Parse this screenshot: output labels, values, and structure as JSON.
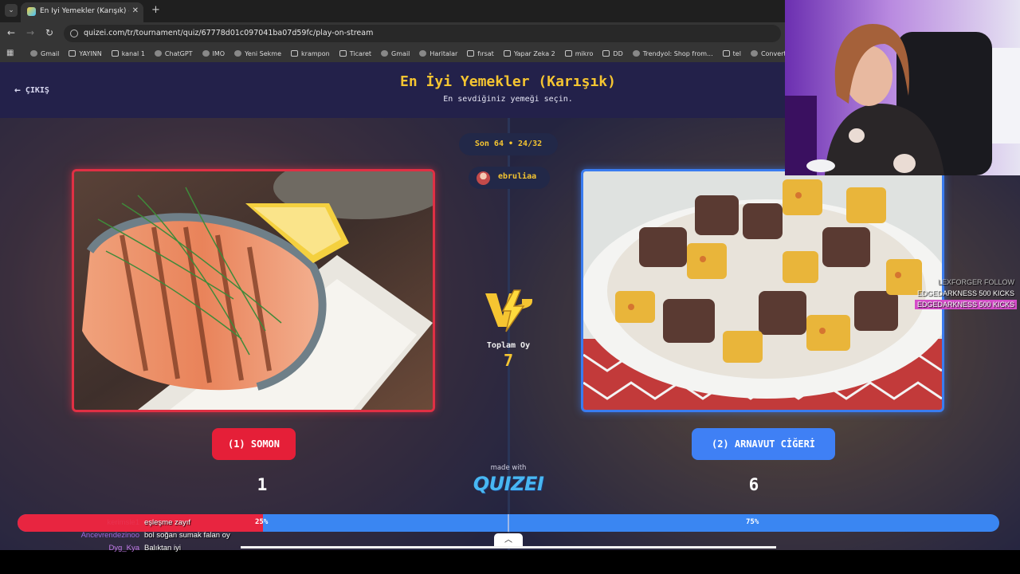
{
  "browser": {
    "tab_title": "En İyi Yemekler (Karışık) - Tier L",
    "url": "quizei.com/tr/tournament/quiz/67778d01c097041ba07d59fc/play-on-stream",
    "bookmarks": [
      "Gmail",
      "YAYINN",
      "kanal 1",
      "ChatGPT",
      "IMO",
      "Yeni Sekme",
      "krampon",
      "Ticaret",
      "Gmail",
      "Haritalar",
      "fırsat",
      "Yapar Zeka 2",
      "mikro",
      "DD",
      "Trendyol: Shop from...",
      "tel",
      "Convert"
    ]
  },
  "quiz": {
    "exit_label": "ÇIKIŞ",
    "title": "En İyi Yemekler (Karışık)",
    "subtitle": "En sevdiğiniz yemeği seçin.",
    "round": "Son 64 • 24/32",
    "streamer": "ebruliaa",
    "total_label": "Toplam Oy",
    "total_votes": "7",
    "left": {
      "label": "(1) SOMON",
      "votes": "1",
      "percent": "25%",
      "fill": 0.25,
      "accent": "#e51f38"
    },
    "right": {
      "label": "(2) ARNAVUT CİĞERİ",
      "votes": "6",
      "percent": "75%",
      "accent": "#3f80f5"
    },
    "made_with": "made with",
    "brand": "QUIZEI"
  },
  "alerts": [
    {
      "text": "LEXFORGER  FOLLOW",
      "style": "dim"
    },
    {
      "text": "EDGEDARKNESS  500 KICKS",
      "style": "plain"
    },
    {
      "text": "EDGEDARKNESS  500 KICKS",
      "style": "hl"
    }
  ],
  "chat": [
    {
      "user": "kerimsle1",
      "message": "eşleşme zayıf",
      "color": "#e83250"
    },
    {
      "user": "Ancevrendezinoo",
      "message": "bol soğan sumak falan oy",
      "color": "#9a6be0"
    },
    {
      "user": "Dyg_Kya",
      "message": "Balıktan iyi",
      "color": "#c27be8"
    }
  ]
}
